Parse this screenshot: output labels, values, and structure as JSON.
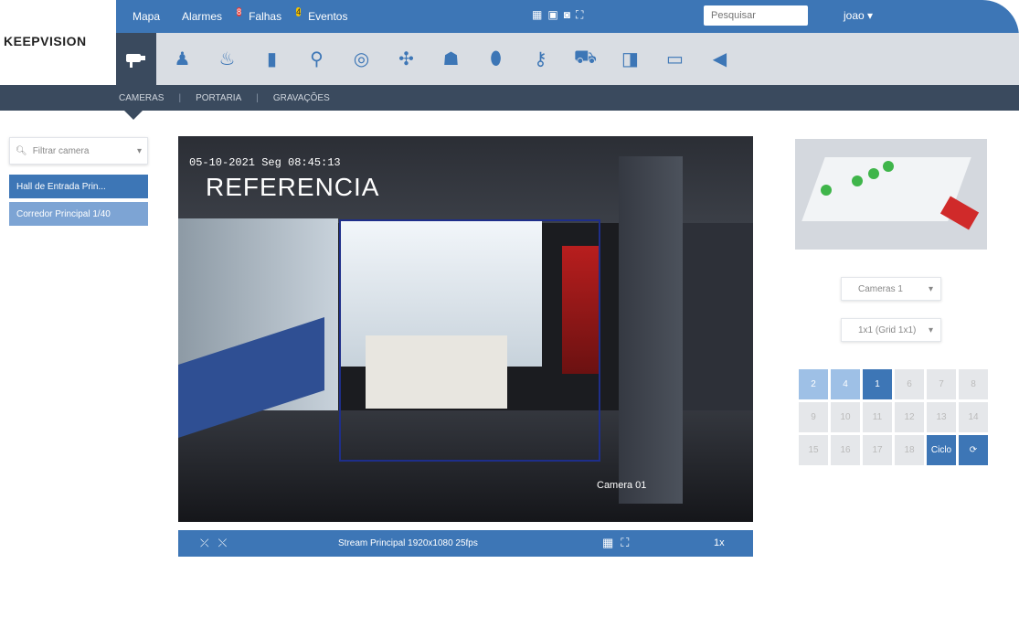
{
  "topnav": {
    "items": [
      {
        "label": "Mapa"
      },
      {
        "label": "Alarmes",
        "badge": "8",
        "badge_color": "#e53935"
      },
      {
        "label": "Falhas",
        "badge": "4",
        "badge_color": "#f5c400"
      },
      {
        "label": "Eventos"
      }
    ],
    "center_icons": [
      "grid-icon",
      "monitor-icon",
      "camera-icon",
      "fullscreen-icon"
    ],
    "search_placeholder": "Pesquisar",
    "user_label": "joao ▾"
  },
  "logo": {
    "text": "KEEPVISION"
  },
  "toolbar": {
    "active_icon": "cctv-icon",
    "tools": [
      "person-icon",
      "fire-icon",
      "door-icon",
      "lamp-icon",
      "sensor-icon",
      "fan-icon",
      "elevator-icon",
      "shield-icon",
      "key-icon",
      "cart-icon",
      "car-icon",
      "screen-icon",
      "speaker-icon"
    ]
  },
  "subnav": {
    "tabs": [
      {
        "label": "CAMERAS"
      },
      {
        "label": "PORTARIA"
      },
      {
        "label": "GRAVAÇÕES"
      }
    ]
  },
  "left": {
    "filter_label": "Filtrar camera",
    "cameras": [
      {
        "label": "Hall de Entrada Prin..."
      },
      {
        "label": "Corredor Principal 1/40"
      }
    ]
  },
  "video": {
    "osd_date": "05-10-2021 Seg 08:45:13",
    "osd_title": "REFERENCIA",
    "osd_camera": "Camera 01",
    "stream_info": "Stream Principal 1920x1080 25fps",
    "zoom_label": "1x"
  },
  "right": {
    "select1": {
      "value": "Cameras 1"
    },
    "select2": {
      "value": "1x1 (Grid 1x1)"
    },
    "pages": [
      {
        "label": "2",
        "style": "light"
      },
      {
        "label": "4",
        "style": "light"
      },
      {
        "label": "1",
        "style": "dark"
      },
      {
        "label": "6",
        "style": "gray"
      },
      {
        "label": "7",
        "style": "gray"
      },
      {
        "label": "8",
        "style": "gray"
      },
      {
        "label": "9",
        "style": "gray"
      },
      {
        "label": "10",
        "style": "gray"
      },
      {
        "label": "11",
        "style": "gray"
      },
      {
        "label": "12",
        "style": "gray"
      },
      {
        "label": "13",
        "style": "gray"
      },
      {
        "label": "14",
        "style": "gray"
      },
      {
        "label": "15",
        "style": "gray"
      },
      {
        "label": "16",
        "style": "gray"
      },
      {
        "label": "17",
        "style": "gray"
      },
      {
        "label": "18",
        "style": "gray"
      },
      {
        "label": "Ciclo",
        "style": "dark"
      },
      {
        "label": "⟳",
        "style": "dark"
      }
    ]
  },
  "colors": {
    "primary": "#3d76b6",
    "dark": "#3a4a5e",
    "toolbar": "#d9dde3"
  }
}
